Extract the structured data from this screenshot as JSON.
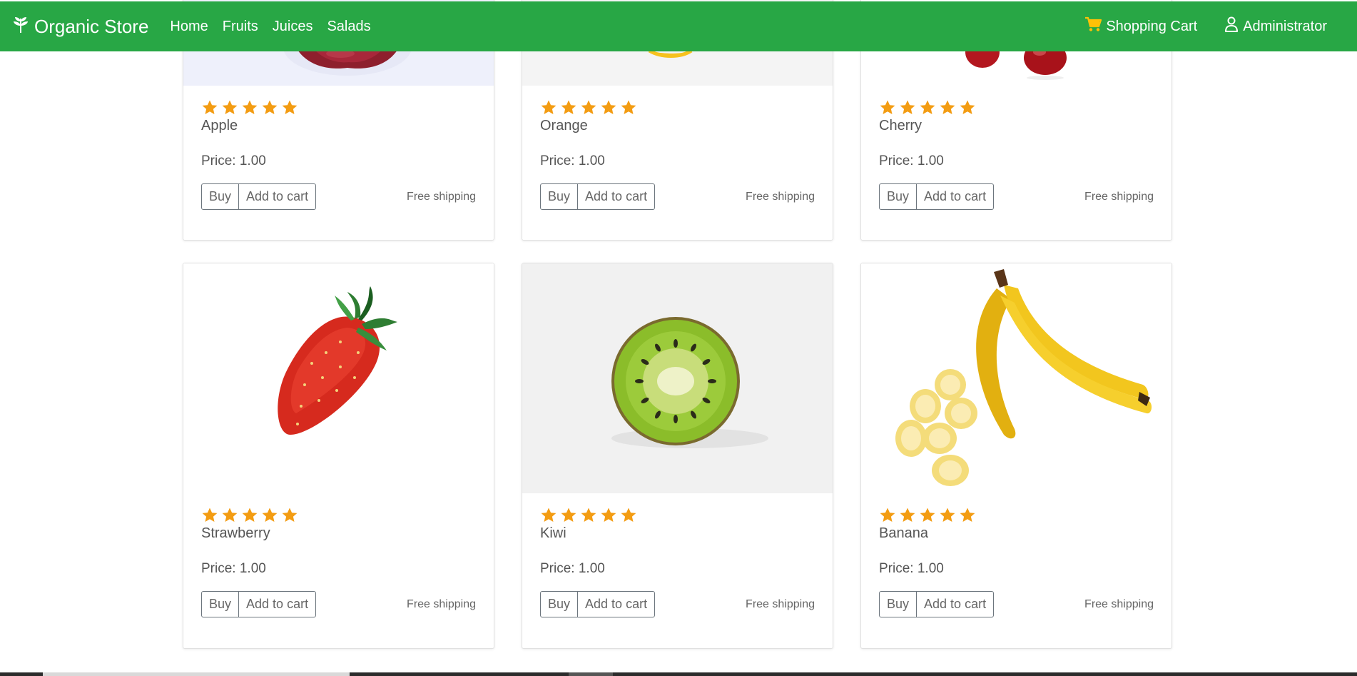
{
  "navbar": {
    "brand": "Organic Store",
    "links": [
      "Home",
      "Fruits",
      "Juices",
      "Salads"
    ],
    "cart_label": "Shopping Cart",
    "user_label": "Administrator",
    "bg_color": "#28a745",
    "cart_icon_color": "#ffc107"
  },
  "product_common": {
    "rating": 5,
    "star_color": "#f39c12",
    "buy_label": "Buy",
    "add_label": "Add to cart",
    "shipping_label": "Free shipping"
  },
  "products": [
    {
      "name": "Apple",
      "price": "Price: 1.00",
      "image": "apple-image"
    },
    {
      "name": "Orange",
      "price": "Price: 1.00",
      "image": "orange-image"
    },
    {
      "name": "Cherry",
      "price": "Price: 1.00",
      "image": "cherry-image"
    },
    {
      "name": "Strawberry",
      "price": "Price: 1.00",
      "image": "strawberry-image"
    },
    {
      "name": "Kiwi",
      "price": "Price: 1.00",
      "image": "kiwi-image"
    },
    {
      "name": "Banana",
      "price": "Price: 1.00",
      "image": "banana-image"
    }
  ]
}
